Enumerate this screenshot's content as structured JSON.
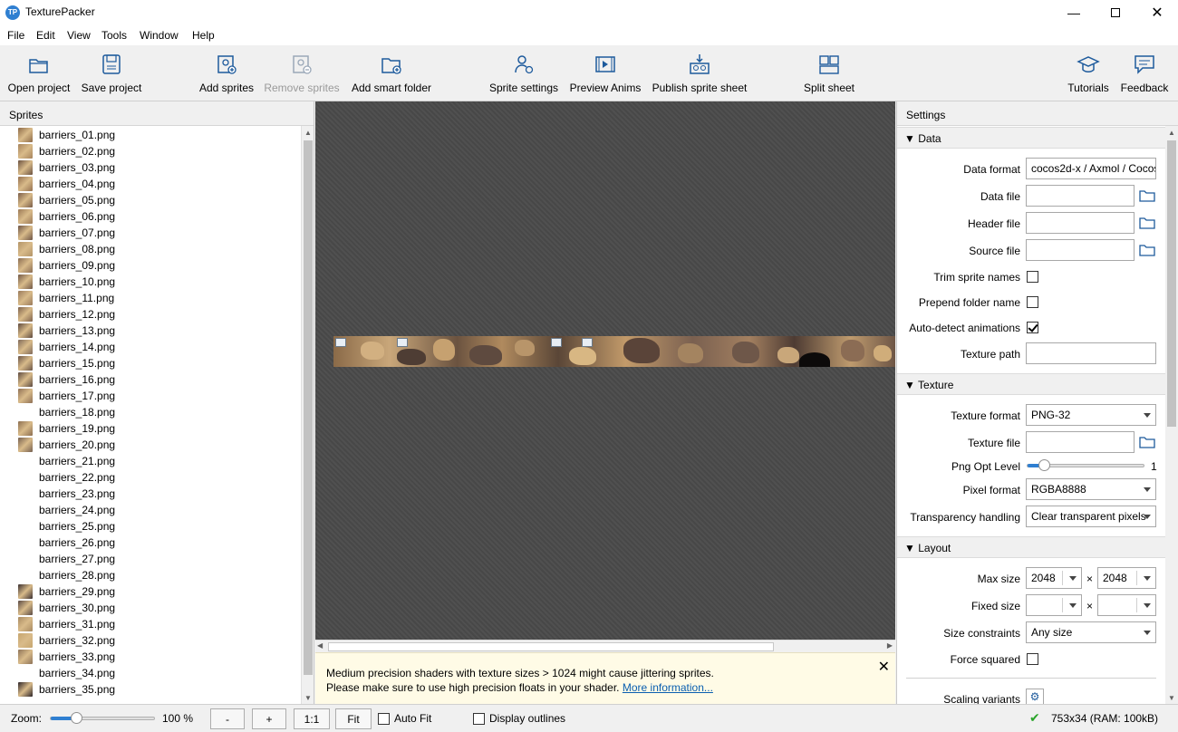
{
  "window": {
    "title": "TexturePacker",
    "app_icon": "TP"
  },
  "menu": [
    "File",
    "Edit",
    "View",
    "Tools",
    "Window",
    "Help"
  ],
  "toolbar": {
    "open_project": "Open project",
    "save_project": "Save project",
    "add_sprites": "Add sprites",
    "remove_sprites": "Remove sprites",
    "add_smart_folder": "Add smart folder",
    "sprite_settings": "Sprite settings",
    "preview_anims": "Preview Anims",
    "publish": "Publish sprite sheet",
    "split_sheet": "Split sheet",
    "tutorials": "Tutorials",
    "feedback": "Feedback"
  },
  "sprites_panel": {
    "title": "Sprites",
    "items": [
      {
        "name": "barriers_01.png",
        "thumb": "#8d6a48"
      },
      {
        "name": "barriers_02.png",
        "thumb": "#a7845c"
      },
      {
        "name": "barriers_03.png",
        "thumb": "#6a5140"
      },
      {
        "name": "barriers_04.png",
        "thumb": "#957050"
      },
      {
        "name": "barriers_05.png",
        "thumb": "#7a5d48"
      },
      {
        "name": "barriers_06.png",
        "thumb": "#9c7a56"
      },
      {
        "name": "barriers_07.png",
        "thumb": "#6d5445"
      },
      {
        "name": "barriers_08.png",
        "thumb": "#b39468"
      },
      {
        "name": "barriers_09.png",
        "thumb": "#8a6c52"
      },
      {
        "name": "barriers_10.png",
        "thumb": "#735a47"
      },
      {
        "name": "barriers_11.png",
        "thumb": "#9a7b5b"
      },
      {
        "name": "barriers_12.png",
        "thumb": "#7e624c"
      },
      {
        "name": "barriers_13.png",
        "thumb": "#5f4a3d"
      },
      {
        "name": "barriers_14.png",
        "thumb": "#806a5a"
      },
      {
        "name": "barriers_15.png",
        "thumb": "#6b5547"
      },
      {
        "name": "barriers_16.png",
        "thumb": "#5d4a40"
      },
      {
        "name": "barriers_17.png",
        "thumb": "#8f7055"
      },
      {
        "name": "barriers_18.png",
        "thumb": ""
      },
      {
        "name": "barriers_19.png",
        "thumb": "#8c6e50"
      },
      {
        "name": "barriers_20.png",
        "thumb": "#766050"
      },
      {
        "name": "barriers_21.png",
        "thumb": ""
      },
      {
        "name": "barriers_22.png",
        "thumb": ""
      },
      {
        "name": "barriers_23.png",
        "thumb": ""
      },
      {
        "name": "barriers_24.png",
        "thumb": ""
      },
      {
        "name": "barriers_25.png",
        "thumb": ""
      },
      {
        "name": "barriers_26.png",
        "thumb": ""
      },
      {
        "name": "barriers_27.png",
        "thumb": ""
      },
      {
        "name": "barriers_28.png",
        "thumb": ""
      },
      {
        "name": "barriers_29.png",
        "thumb": "#3a2f30"
      },
      {
        "name": "barriers_30.png",
        "thumb": "#5a4a44"
      },
      {
        "name": "barriers_31.png",
        "thumb": "#a88a62"
      },
      {
        "name": "barriers_32.png",
        "thumb": "#c7a66f"
      },
      {
        "name": "barriers_33.png",
        "thumb": "#8e7358"
      },
      {
        "name": "barriers_34.png",
        "thumb": ""
      },
      {
        "name": "barriers_35.png",
        "thumb": "#2d2428"
      }
    ]
  },
  "notice": {
    "line1": "Medium precision shaders with texture sizes > 1024 might cause jittering sprites.",
    "line2": "Please make sure to use high precision floats in your shader.",
    "link": "More information..."
  },
  "settings": {
    "title": "Settings",
    "data": {
      "header": "Data",
      "data_format_label": "Data format",
      "data_format_value": "cocos2d-x / Axmol / Cocos",
      "data_file_label": "Data file",
      "header_file_label": "Header file",
      "source_file_label": "Source file",
      "trim_label": "Trim sprite names",
      "prepend_label": "Prepend folder name",
      "autodetect_label": "Auto-detect animations",
      "texture_path_label": "Texture path"
    },
    "texture": {
      "header": "Texture",
      "format_label": "Texture format",
      "format_value": "PNG-32",
      "file_label": "Texture file",
      "png_opt_label": "Png Opt Level",
      "png_opt_value": "1",
      "png_opt_level": 1,
      "png_opt_max": 7,
      "pixel_label": "Pixel format",
      "pixel_value": "RGBA8888",
      "transparency_label": "Transparency handling",
      "transparency_value": "Clear transparent pixels"
    },
    "layout": {
      "header": "Layout",
      "max_size_label": "Max size",
      "max_w": "2048",
      "max_h": "2048",
      "times": "×",
      "fixed_size_label": "Fixed size",
      "constraints_label": "Size constraints",
      "constraints_value": "Any size",
      "force_squared_label": "Force squared",
      "scaling_label": "Scaling variants"
    }
  },
  "statusbar": {
    "zoom_label": "Zoom:",
    "zoom_value": "100 %",
    "zoom_fraction": 0.25,
    "minus": "-",
    "plus": "+",
    "one_to_one": "1:1",
    "fit": "Fit",
    "auto_fit": "Auto Fit",
    "display_outlines": "Display outlines",
    "info": "753x34 (RAM: 100kB)"
  }
}
